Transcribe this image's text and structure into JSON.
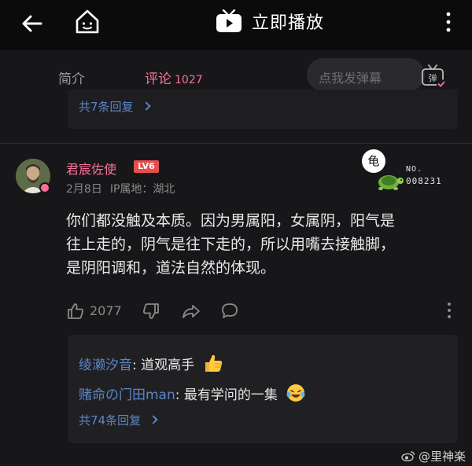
{
  "topbar": {
    "play_label": "立即播放",
    "icons": [
      "back-arrow-icon",
      "home-tv-icon",
      "tv-play-icon",
      "more-vertical-icon"
    ]
  },
  "tabs": {
    "intro_label": "简介",
    "comments_label": "评论",
    "comments_count": "1027",
    "active_color": "#fb7299"
  },
  "danmaku": {
    "placeholder": "点我发弹幕",
    "icon_label": "弹"
  },
  "prev_reply": {
    "count_label": "共7条回复"
  },
  "comment": {
    "username": "君宸佐使",
    "level": "LV6",
    "date": "2月8日",
    "ip_location": "IP属地：湖北",
    "fan_badge": {
      "bubble": "龟",
      "no_label": "NO.",
      "no_value": "008231"
    },
    "content_lines": [
      "你们都没触及本质。因为男属阳，女属阴，阳气是",
      "往上走的，阴气是往下走的，所以用嘴去接触脚，",
      "是阴阳调和，道法自然的体现。"
    ],
    "likes": "2077",
    "replies": [
      {
        "user": "绫濑汐音",
        "sep": ": ",
        "text": "道观高手",
        "emoji": "thumbs-up-emoji"
      },
      {
        "user": "赌命の门田man",
        "sep": ": ",
        "text": "最有学问的一集",
        "emoji": "laughing-tears-emoji"
      }
    ],
    "reply_count_label": "共74条回复"
  },
  "watermark": {
    "text": "@里神楽"
  },
  "colors": {
    "background": "#17171a",
    "topbar": "#0b0b0c",
    "pink": "#fb7299",
    "link_blue": "#5b85c6",
    "level_red": "#e84d4d"
  }
}
